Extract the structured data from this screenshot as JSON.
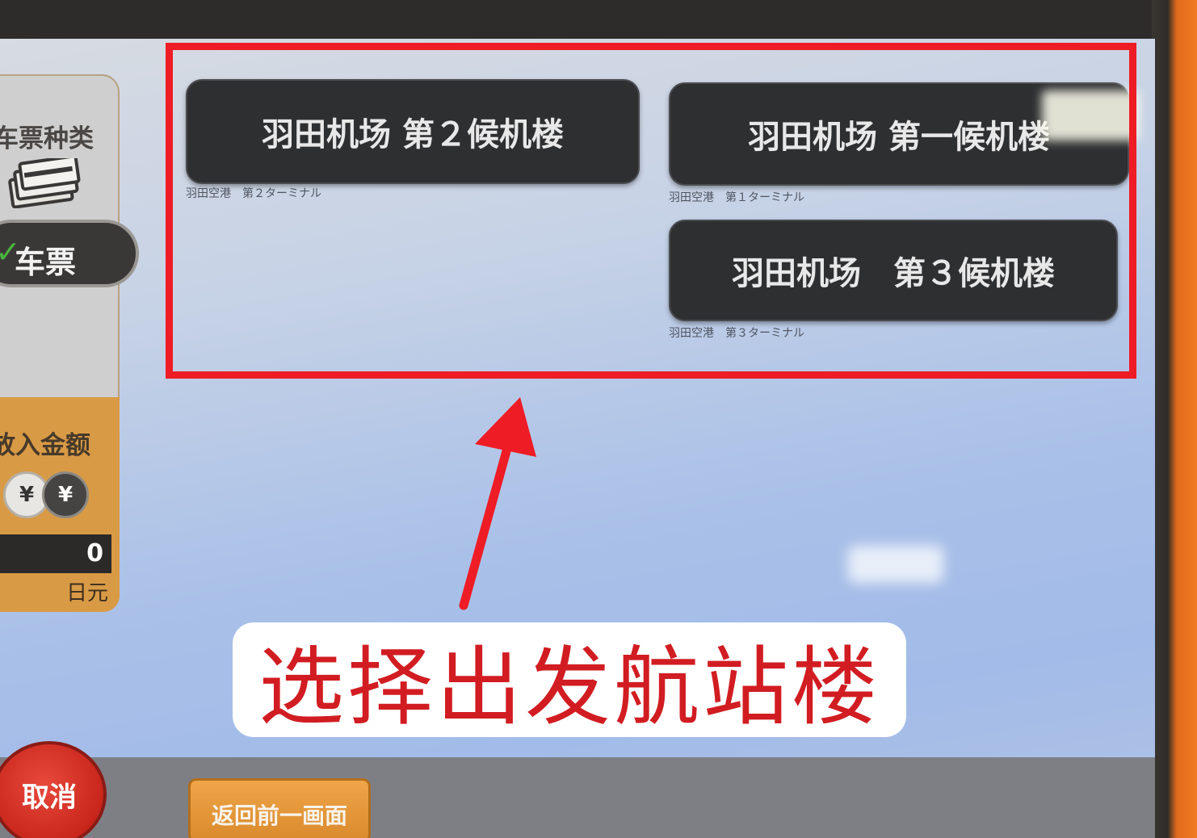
{
  "sidebar": {
    "ticket_type_title": "车票种类",
    "ticket_button_check": "✓",
    "ticket_button_label": "车票",
    "amount_title": "放入金额",
    "coin_symbol_1": "¥",
    "coin_symbol_2": "¥",
    "amount_value": "0",
    "currency": "日元"
  },
  "terminals": [
    {
      "label": "羽田机场 第２候机楼",
      "sublabel": "羽田空港　第２ターミナル"
    },
    {
      "label": "羽田机场 第一候机楼",
      "sublabel": "羽田空港　第１ターミナル"
    },
    {
      "label": "羽田机场　第３候机楼",
      "sublabel": "羽田空港　第３ターミナル"
    }
  ],
  "caption": "选择出发航站楼",
  "footer": {
    "cancel_label": "取消",
    "back_label": "返回前一画面"
  },
  "colors": {
    "highlight": "#ee1c25",
    "caption_text": "#d11d22",
    "button_bg": "#2e2f31",
    "cancel_bg": "#c9261c",
    "back_bg": "#e0962f"
  }
}
